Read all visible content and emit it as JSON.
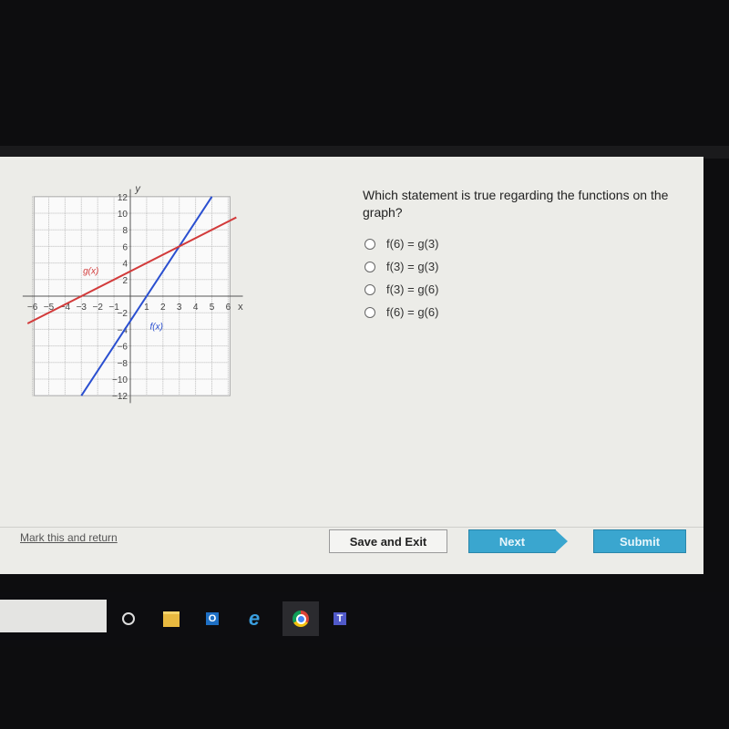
{
  "question": {
    "text": "Which statement is true regarding the functions on the graph?",
    "options": [
      "f(6) = g(3)",
      "f(3) = g(3)",
      "f(3) = g(6)",
      "f(6) = g(6)"
    ]
  },
  "footer": {
    "mark_label": "Mark this and return",
    "save_label": "Save and Exit",
    "next_label": "Next",
    "submit_label": "Submit"
  },
  "taskbar": {
    "icons": [
      "cortana-circle-icon",
      "file-explorer-icon",
      "outlook-icon",
      "internet-explorer-icon",
      "chrome-icon",
      "teams-icon"
    ],
    "outlook_text": "O",
    "teams_text": "T"
  },
  "chart_data": {
    "type": "line",
    "xlim": [
      -6,
      6
    ],
    "ylim": [
      -12,
      12
    ],
    "xlabel": "x",
    "ylabel": "y",
    "x_ticks": [
      -6,
      -5,
      -4,
      -3,
      -2,
      -1,
      1,
      2,
      3,
      4,
      5,
      6
    ],
    "y_ticks": [
      -12,
      -10,
      -8,
      -6,
      -4,
      -2,
      2,
      4,
      6,
      8,
      10,
      12
    ],
    "grid": true,
    "series": [
      {
        "name": "f(x)",
        "color": "#2a4fd0",
        "points": [
          [
            -3,
            -12
          ],
          [
            5,
            12
          ]
        ],
        "label_at": [
          1.2,
          -4
        ]
      },
      {
        "name": "g(x)",
        "color": "#d23a3a",
        "points": [
          [
            -6.3,
            -3.3
          ],
          [
            6.5,
            9.5
          ]
        ],
        "label_at": [
          -2.9,
          2.7
        ]
      }
    ]
  }
}
